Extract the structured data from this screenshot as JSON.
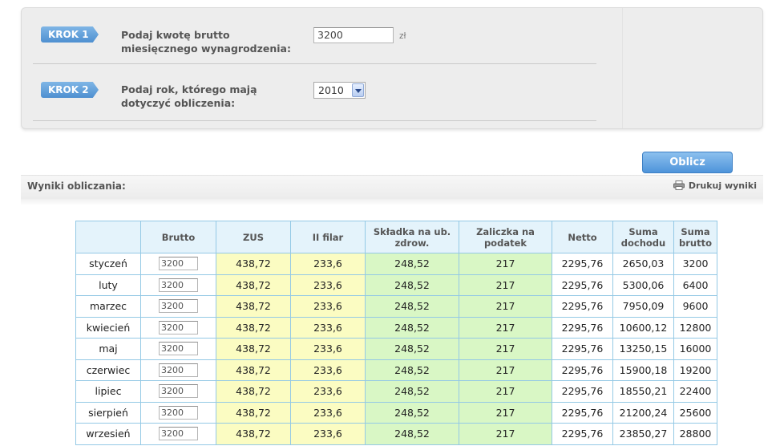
{
  "steps": [
    {
      "badge": "KROK 1",
      "label": "Podaj kwotę brutto miesięcznego wynagrodzenia:",
      "value": "3200",
      "unit": "zł"
    },
    {
      "badge": "KROK 2",
      "label": "Podaj rok, którego mają dotyczyć obliczenia:",
      "value": "2010"
    }
  ],
  "calc_button": "Oblicz",
  "results": {
    "title": "Wyniki obliczania:",
    "print_label": "Drukuj wyniki",
    "headers": [
      "",
      "Brutto",
      "ZUS",
      "II filar",
      "Składka na ub. zdrow.",
      "Zaliczka na podatek",
      "Netto",
      "Suma dochodu",
      "Suma brutto"
    ],
    "rows": [
      {
        "month": "styczeń",
        "brutto": "3200",
        "zus": "438,72",
        "filar": "233,6",
        "zdrow": "248,52",
        "zaliczka": "217",
        "netto": "2295,76",
        "suma_dochodu": "2650,03",
        "suma_brutto": "3200"
      },
      {
        "month": "luty",
        "brutto": "3200",
        "zus": "438,72",
        "filar": "233,6",
        "zdrow": "248,52",
        "zaliczka": "217",
        "netto": "2295,76",
        "suma_dochodu": "5300,06",
        "suma_brutto": "6400"
      },
      {
        "month": "marzec",
        "brutto": "3200",
        "zus": "438,72",
        "filar": "233,6",
        "zdrow": "248,52",
        "zaliczka": "217",
        "netto": "2295,76",
        "suma_dochodu": "7950,09",
        "suma_brutto": "9600"
      },
      {
        "month": "kwiecień",
        "brutto": "3200",
        "zus": "438,72",
        "filar": "233,6",
        "zdrow": "248,52",
        "zaliczka": "217",
        "netto": "2295,76",
        "suma_dochodu": "10600,12",
        "suma_brutto": "12800"
      },
      {
        "month": "maj",
        "brutto": "3200",
        "zus": "438,72",
        "filar": "233,6",
        "zdrow": "248,52",
        "zaliczka": "217",
        "netto": "2295,76",
        "suma_dochodu": "13250,15",
        "suma_brutto": "16000"
      },
      {
        "month": "czerwiec",
        "brutto": "3200",
        "zus": "438,72",
        "filar": "233,6",
        "zdrow": "248,52",
        "zaliczka": "217",
        "netto": "2295,76",
        "suma_dochodu": "15900,18",
        "suma_brutto": "19200"
      },
      {
        "month": "lipiec",
        "brutto": "3200",
        "zus": "438,72",
        "filar": "233,6",
        "zdrow": "248,52",
        "zaliczka": "217",
        "netto": "2295,76",
        "suma_dochodu": "18550,21",
        "suma_brutto": "22400"
      },
      {
        "month": "sierpień",
        "brutto": "3200",
        "zus": "438,72",
        "filar": "233,6",
        "zdrow": "248,52",
        "zaliczka": "217",
        "netto": "2295,76",
        "suma_dochodu": "21200,24",
        "suma_brutto": "25600"
      },
      {
        "month": "wrzesień",
        "brutto": "3200",
        "zus": "438,72",
        "filar": "233,6",
        "zdrow": "248,52",
        "zaliczka": "217",
        "netto": "2295,76",
        "suma_dochodu": "23850,27",
        "suma_brutto": "28800"
      }
    ]
  },
  "colors": {
    "accent": "#4e94da",
    "zus_fill": "#fbfcc2",
    "health_fill": "#d9f7c5",
    "header_fill": "#e4f3fb",
    "grid": "#94c9e5"
  }
}
